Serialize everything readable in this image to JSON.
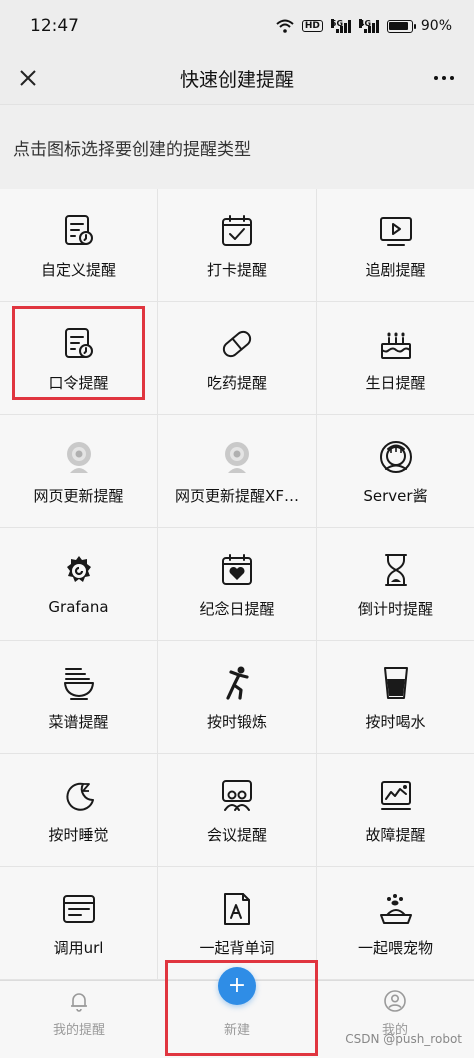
{
  "status": {
    "time": "12:47",
    "hd": "HD",
    "sig1": "5G",
    "sig2": "4G",
    "battery": "90%",
    "battery_level": 0.9
  },
  "nav": {
    "title": "快速创建提醒"
  },
  "subtitle": "点击图标选择要创建的提醒类型",
  "items": [
    {
      "label": "自定义提醒",
      "icon": "doc-clock-icon"
    },
    {
      "label": "打卡提醒",
      "icon": "calendar-check-icon"
    },
    {
      "label": "追剧提醒",
      "icon": "tv-play-icon"
    },
    {
      "label": "口令提醒",
      "icon": "doc-clock-icon"
    },
    {
      "label": "吃药提醒",
      "icon": "pill-icon"
    },
    {
      "label": "生日提醒",
      "icon": "cake-icon"
    },
    {
      "label": "网页更新提醒",
      "icon": "webcam-icon"
    },
    {
      "label": "网页更新提醒XF…",
      "icon": "webcam-icon"
    },
    {
      "label": "Server酱",
      "icon": "server-avatar-icon"
    },
    {
      "label": "Grafana",
      "icon": "grafana-icon"
    },
    {
      "label": "纪念日提醒",
      "icon": "calendar-heart-icon"
    },
    {
      "label": "倒计时提醒",
      "icon": "hourglass-icon"
    },
    {
      "label": "菜谱提醒",
      "icon": "bowl-icon"
    },
    {
      "label": "按时锻炼",
      "icon": "exercise-icon"
    },
    {
      "label": "按时喝水",
      "icon": "water-glass-icon"
    },
    {
      "label": "按时睡觉",
      "icon": "moon-sleep-icon"
    },
    {
      "label": "会议提醒",
      "icon": "meeting-icon"
    },
    {
      "label": "故障提醒",
      "icon": "fault-chart-icon"
    },
    {
      "label": "调用url",
      "icon": "browser-window-icon"
    },
    {
      "label": "一起背单词",
      "icon": "word-card-icon"
    },
    {
      "label": "一起喂宠物",
      "icon": "pet-bowl-icon"
    }
  ],
  "tabbar": {
    "left": "我的提醒",
    "center": "新建",
    "right": "我的"
  },
  "fab": "+",
  "watermark": "CSDN @push_robot",
  "colors": {
    "accent": "#2f8de6",
    "highlight": "#e0353f"
  }
}
